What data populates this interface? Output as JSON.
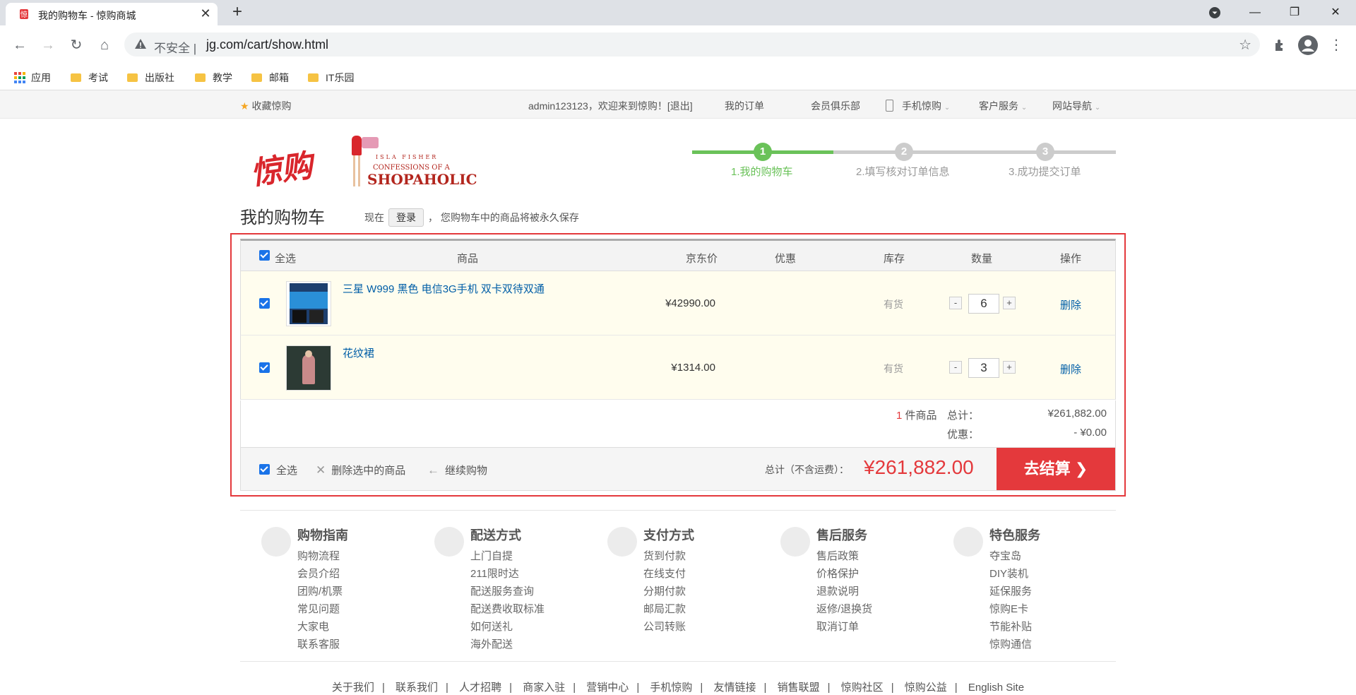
{
  "browser": {
    "tab_title": "我的购物车 - 惊购商城",
    "insecure_label": "不安全",
    "url": "jg.com/cart/show.html",
    "bookmarks": [
      "应用",
      "考试",
      "出版社",
      "教学",
      "邮箱",
      "IT乐园"
    ]
  },
  "topbar": {
    "favorite": "收藏惊购",
    "greeting": "admin123123，欢迎来到惊购！[退出]",
    "my_orders": "我的订单",
    "member_club": "会员俱乐部",
    "mobile": "手机惊购",
    "customer_service": "客户服务",
    "site_nav": "网站导航"
  },
  "logo": {
    "chinese": "惊购",
    "english_line1": "ISLA FISHER",
    "english_line2": "CONFESSIONS OF A",
    "english_line3": "SHOPAHOLIC"
  },
  "steps": [
    {
      "num": "1",
      "label": "1.我的购物车",
      "active": true
    },
    {
      "num": "2",
      "label": "2.填写核对订单信息",
      "active": false
    },
    {
      "num": "3",
      "label": "3.成功提交订单",
      "active": false
    }
  ],
  "page": {
    "title": "我的购物车",
    "note_prefix": "现在",
    "login_button": "登录",
    "note_suffix": "，  您购物车中的商品将被永久保存"
  },
  "cart": {
    "headers": {
      "select_all": "全选",
      "product": "商品",
      "price": "京东价",
      "discount": "优惠",
      "stock": "库存",
      "quantity": "数量",
      "action": "操作"
    },
    "items": [
      {
        "name": "三星 W999 黑色 电信3G手机 双卡双待双通",
        "price": "¥42990.00",
        "stock": "有货",
        "qty": "6",
        "delete": "删除"
      },
      {
        "name": "花纹裙",
        "price": "¥1314.00",
        "stock": "有货",
        "qty": "3",
        "delete": "删除"
      }
    ],
    "summary": {
      "count": "1",
      "count_unit": "件商品",
      "total_label": "总计：",
      "total_value": "¥261,882.00",
      "discount_label": "优惠：",
      "discount_value": "- ¥0.00"
    },
    "footer": {
      "select_all": "全选",
      "delete_selected": "删除选中的商品",
      "continue_shopping": "继续购物",
      "total_label": "总计（不含运费）：",
      "total_value": "¥261,882.00",
      "checkout": "去结算"
    }
  },
  "help": [
    {
      "title": "购物指南",
      "links": [
        "购物流程",
        "会员介绍",
        "团购/机票",
        "常见问题",
        "大家电",
        "联系客服"
      ]
    },
    {
      "title": "配送方式",
      "links": [
        "上门自提",
        "211限时达",
        "配送服务查询",
        "配送费收取标准",
        "如何送礼",
        "海外配送"
      ]
    },
    {
      "title": "支付方式",
      "links": [
        "货到付款",
        "在线支付",
        "分期付款",
        "邮局汇款",
        "公司转账"
      ]
    },
    {
      "title": "售后服务",
      "links": [
        "售后政策",
        "价格保护",
        "退款说明",
        "返修/退换货",
        "取消订单"
      ]
    },
    {
      "title": "特色服务",
      "links": [
        "夺宝岛",
        "DIY装机",
        "延保服务",
        "惊购E卡",
        "节能补贴",
        "惊购通信"
      ]
    }
  ],
  "bottom_links": [
    "关于我们",
    "联系我们",
    "人才招聘",
    "商家入驻",
    "营销中心",
    "手机惊购",
    "友情链接",
    "销售联盟",
    "惊购社区",
    "惊购公益",
    "English Site"
  ]
}
